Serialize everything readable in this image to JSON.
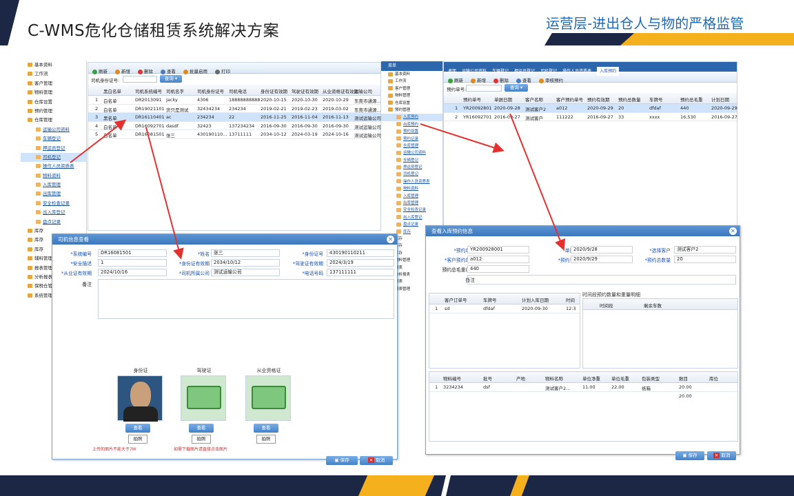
{
  "slide": {
    "title": "C-WMS危化仓储租赁系统解决方案",
    "subtitle": "运营层-进出仓人与物的严格监管",
    "colors": {
      "navy": "#1c2745",
      "gold": "#f5b01e",
      "accent": "#1f6ab5",
      "arrow": "#e53030"
    }
  },
  "left_app": {
    "tree": [
      {
        "label": "基本资料",
        "level": 1
      },
      {
        "label": "工作流",
        "level": 1
      },
      {
        "label": "客户管理",
        "level": 1
      },
      {
        "label": "物料管理",
        "level": 1
      },
      {
        "label": "仓库设置",
        "level": 1
      },
      {
        "label": "预约管理",
        "level": 1
      },
      {
        "label": "仓库管理",
        "level": 1
      },
      {
        "label": "运输公司资料",
        "level": 2
      },
      {
        "label": "车辆登记",
        "level": 2
      },
      {
        "label": "押运员登记",
        "level": 2
      },
      {
        "label": "司机登记",
        "level": 2,
        "selected": true
      },
      {
        "label": "操作人员资质表",
        "level": 2
      },
      {
        "label": "物料资料",
        "level": 2
      },
      {
        "label": "入库管理",
        "level": 2
      },
      {
        "label": "出库管理",
        "level": 2
      },
      {
        "label": "安全检查记录",
        "level": 2
      },
      {
        "label": "出入库登记",
        "level": 2
      },
      {
        "label": "盘点记录",
        "level": 2
      },
      {
        "label": "库存",
        "level": 1
      },
      {
        "label": "库存",
        "level": 1
      },
      {
        "label": "库存",
        "level": 1
      },
      {
        "label": "辅料管理",
        "level": 1
      },
      {
        "label": "报表管理",
        "level": 1
      },
      {
        "label": "分析报表",
        "level": 1
      },
      {
        "label": "保税仓管理",
        "level": 1
      },
      {
        "label": "系统管理",
        "level": 1
      }
    ],
    "toolbar": [
      "刷新",
      "新增",
      "删除",
      "查看",
      "批量启用",
      "打印"
    ],
    "search": {
      "label": "司机身份证号:",
      "button": "查询"
    },
    "columns": [
      "黑白名单",
      "司机系统编号",
      "司机名字",
      "司机身份证号",
      "司机电话",
      "身份证有效期",
      "驾驶证有效期",
      "从业资格证有效期",
      "运输公司"
    ],
    "rows": [
      {
        "n": "1",
        "c": [
          "白名单",
          "DR2013091",
          "Jacky",
          "4306",
          "18888888888",
          "2020-10-15",
          "2020-10-30",
          "2020-10-29",
          "东莞市通源..."
        ]
      },
      {
        "n": "2",
        "c": [
          "白名单",
          "DR19021101",
          "货只是测试",
          "32434234",
          "234234",
          "2019-02-21",
          "2019-02-23",
          "2019-03-02",
          "东莞市通源..."
        ]
      },
      {
        "n": "3",
        "c": [
          "黑名单",
          "DR16110401",
          "ac",
          "234234",
          "22",
          "2016-11-25",
          "2016-11-04",
          "2016-11-13",
          "测试运输公司"
        ],
        "selected": true
      },
      {
        "n": "4",
        "c": [
          "白名单",
          "DR16092701",
          "dasdf",
          "32423",
          "137234234",
          "2016-09-30",
          "2016-09-30",
          "2016-09-30",
          "测试运输公司"
        ]
      },
      {
        "n": "5",
        "c": [
          "白名单",
          "DR16081501",
          "张三",
          "430190110...",
          "13711111",
          "2034-10-12",
          "2024-03-19",
          "2024-10-16",
          "测试运输公司"
        ]
      }
    ]
  },
  "driver_dialog": {
    "title": "司机信息查看",
    "fields": {
      "sys_no_label": "*系统编号",
      "sys_no": "DR16081501",
      "name_label": "*姓名",
      "name": "张三",
      "id_label": "*身份证号",
      "id_no": "430190110211",
      "safety_label": "*安全描述",
      "safety": "1",
      "id_valid_label": "*身份证有效期",
      "id_valid": "2034/10/12",
      "license_valid_label": "*驾驶证有效期",
      "license_valid": "2024/3/19",
      "qual_valid_label": "*从业证有效期",
      "qual_valid": "2024/10/16",
      "company_label": "*司机所属公司",
      "company": "测试运输公司",
      "phone_label": "*电话号码",
      "phone": "137111111",
      "remark_label": "备注"
    },
    "photos": [
      {
        "caption": "身份证",
        "view": "查看",
        "shoot": "拍照"
      },
      {
        "caption": "驾驶证",
        "view": "查看",
        "shoot": "拍照"
      },
      {
        "caption": "从业资格证",
        "view": "查看",
        "shoot": "拍照"
      }
    ],
    "hint1": "上传的图片不能大于7M",
    "hint2": "如需下载图片请直接点击图片",
    "save": "保存",
    "cancel": "取消"
  },
  "right_app": {
    "tree_top": [
      "基本资料",
      "工作流",
      "客户管理",
      "物料管理",
      "仓库设置",
      "预约管理"
    ],
    "tree_sub": [
      "入库预约",
      "出库预约",
      "预约设置",
      "预约记录"
    ],
    "tree_mid": [
      "仓库管理",
      "运输公司资料",
      "车辆登记",
      "押运员登记",
      "司机登记",
      "操作人员资质表",
      "物料资料",
      "入库管理",
      "出库管理",
      "安全检查记录",
      "出入库登记",
      "盘点记录",
      "库存"
    ],
    "tree_bot": [
      "库存",
      "库存",
      "库存",
      "辅料管理",
      "报表",
      "分析报表",
      "报表",
      "报表管理"
    ],
    "tabs": [
      "桌面",
      "运输公司资料",
      "车辆登记",
      "押运员登记",
      "司机登记",
      "操作人员资质表",
      "入库预约"
    ],
    "toolbar": [
      "刷新",
      "新增",
      "删除",
      "查看",
      "审核预约"
    ],
    "search": {
      "label": "预约单号:",
      "button": "查询"
    },
    "columns": [
      "预约单号",
      "单据日期",
      "客户名称",
      "客户预约单号",
      "预约有效期",
      "预约总数量",
      "车牌号",
      "预约总毛重",
      "计划日期"
    ],
    "rows": [
      {
        "n": "1",
        "c": [
          "YR20092801",
          "2020-09-28",
          "测试客户2",
          "a012",
          "2020-09-29",
          "20",
          "dfdaf",
          "440",
          "2020-09-29"
        ],
        "selected": true
      },
      {
        "n": "2",
        "c": [
          "YR16092701",
          "2016-09-27",
          "测试客户",
          "111222",
          "2016-09-27",
          "33",
          "xxxx",
          "16,530",
          "2016-09-27"
        ]
      }
    ]
  },
  "booking_dialog": {
    "title": "查看入库预约信息",
    "fields": {
      "no_label": "*预约单号",
      "no": "YR200928001",
      "date_label": "*单据日期",
      "date": "2020/9/28",
      "cust_label": "*选择客户",
      "cust": "测试客户2",
      "cust_no_label": "*客户预约单号",
      "cust_no": "a012",
      "valid_label": "*预约有效期",
      "valid": "2020/9/29",
      "qty_label": "*预约总数量",
      "qty": "20",
      "weight_label": "预约总毛重(kg)",
      "weight": "440",
      "remark_label": "备注"
    },
    "plan_title": "时间段预约数量和重量明细",
    "grid1_cols": [
      "客户订单号",
      "车牌号",
      "计划入库日期",
      "时间"
    ],
    "grid1_rows": [
      {
        "n": "1",
        "c": [
          "sd",
          "dfdaf",
          "2020-09-30",
          "12:3"
        ]
      }
    ],
    "grid2_cols": [
      "时间段",
      "剩余车数"
    ],
    "grid3_cols": [
      "物料编号",
      "批号",
      "产地",
      "物料名称",
      "单位净重",
      "单位毛重",
      "包装类型",
      "数目",
      "库位"
    ],
    "grid3_rows": [
      {
        "n": "1",
        "c": [
          "3234234",
          "dsf",
          "",
          "测试客户2...",
          "11.00",
          "22.00",
          "纸箱",
          "20.00",
          ""
        ]
      }
    ],
    "total": "20.00",
    "save": "保存",
    "cancel": "取消"
  }
}
